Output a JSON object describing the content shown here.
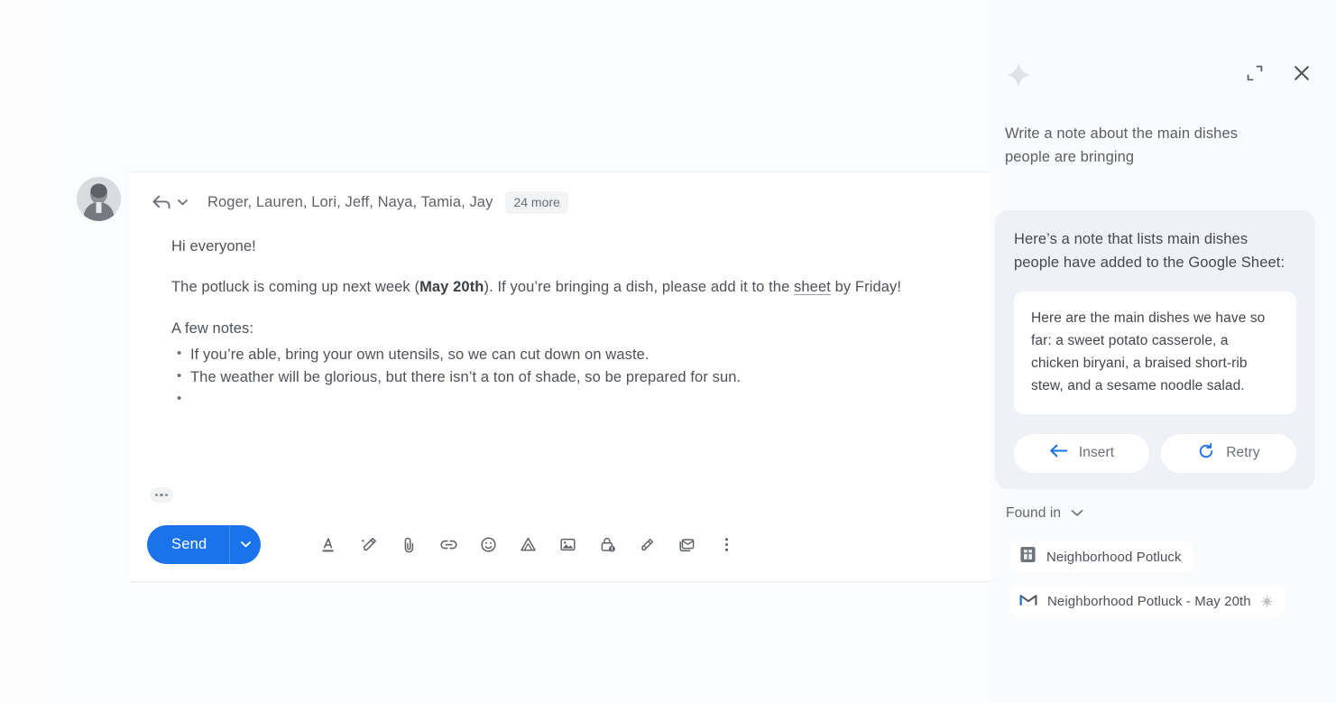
{
  "app": {
    "name": "Gmail Compose with Gemini side panel",
    "accent_blue": "#1a73e8",
    "panel_bg": "#fafbfc",
    "card_bg": "#eef1f6",
    "text_gray": "#5f6368"
  },
  "compose": {
    "avatar_name": "sender-avatar",
    "reply_icon": "reply-arrow-icon",
    "reply_caret_icon": "chevron-down-icon",
    "recipients": "Roger, Lauren, Lori, Jeff, Naya, Tamia, Jay",
    "more_chip": "24 more",
    "body": {
      "greeting": "Hi everyone!",
      "paragraph_prefix": "The potluck is coming up next week (",
      "paragraph_bold": "May 20th",
      "paragraph_mid": "). If you’re bringing a dish, please add it to the ",
      "link_text": "sheet",
      "paragraph_suffix": " by Friday!",
      "notes_heading": "A few notes:",
      "bullets": [
        "If you’re able, bring your own utensils, so we can cut down on waste.",
        "The weather will be glorious, but there isn’t a ton of shade, so be prepared for sun.",
        ""
      ]
    },
    "trimmed_content": "trimmed-content-ellipsis",
    "toolbar": {
      "send_label": "Send",
      "send_caret_icon": "chevron-down-icon",
      "icons": [
        {
          "name": "formatting-options-icon",
          "title": "Formatting options"
        },
        {
          "name": "gemini-pen-icon",
          "title": "Help me write"
        },
        {
          "name": "attach-file-icon",
          "title": "Attach files"
        },
        {
          "name": "insert-link-icon",
          "title": "Insert link"
        },
        {
          "name": "insert-emoji-icon",
          "title": "Insert emoji"
        },
        {
          "name": "insert-drive-file-icon",
          "title": "Insert files using Drive"
        },
        {
          "name": "insert-photo-icon",
          "title": "Insert photo"
        },
        {
          "name": "confidential-mode-icon",
          "title": "Toggle confidential mode"
        },
        {
          "name": "insert-signature-icon",
          "title": "Insert signature"
        },
        {
          "name": "email-templates-icon",
          "title": "More options"
        },
        {
          "name": "more-options-icon",
          "title": "More options"
        }
      ]
    }
  },
  "gemini": {
    "sparkle_icon": "gemini-sparkle-icon",
    "expand_icon": "expand-panel-icon",
    "close_icon": "close-icon",
    "prompt": "Write a note about the main dishes people are bringing",
    "response": {
      "intro": "Here’s a note that lists main dishes people have added to the Google Sheet:",
      "note": "Here are the main dishes we have so far: a sweet potato casserole, a chicken biryani, a braised short-rib stew, and a sesame noodle salad."
    },
    "actions": [
      {
        "name": "insert-button",
        "label": "Insert",
        "icon": "arrow-left-icon"
      },
      {
        "name": "retry-button",
        "label": "Retry",
        "icon": "refresh-icon"
      }
    ],
    "found_in": {
      "label": "Found in",
      "chevron_icon": "chevron-down-icon",
      "sources": [
        {
          "name": "source-chip-sheets",
          "label": "Neighborhood Potluck",
          "icon": "google-sheets-icon",
          "trailing_icon": null
        },
        {
          "name": "source-chip-gmail",
          "label": "Neighborhood Potluck - May 20th",
          "icon": "gmail-icon",
          "trailing_icon": "attachment-dot-icon"
        }
      ]
    }
  }
}
